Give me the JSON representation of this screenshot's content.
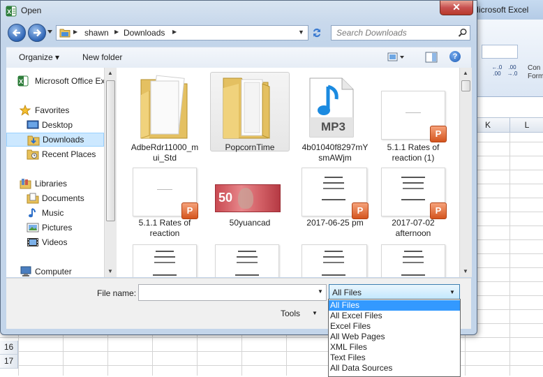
{
  "excel": {
    "title": "Microsoft Excel",
    "columns": [
      "K",
      "L"
    ],
    "rows": [
      "16",
      "17"
    ],
    "ribbon_partial_label": "Con\nForm"
  },
  "dialog": {
    "title": "Open",
    "close_glyph": "✕",
    "address": {
      "segments": [
        "shawn",
        "Downloads"
      ]
    },
    "search": {
      "placeholder": "Search Downloads"
    },
    "toolbar": {
      "organize": "Organize ▾",
      "new_folder": "New folder",
      "help_glyph": "?"
    },
    "nav": {
      "items": [
        {
          "label": "Microsoft Office Ex",
          "icon": "excel-icon"
        },
        {
          "label": "Favorites",
          "icon": "star-icon"
        },
        {
          "label": "Desktop",
          "icon": "desktop-icon"
        },
        {
          "label": "Downloads",
          "icon": "downloads-folder-icon",
          "selected": true
        },
        {
          "label": "Recent Places",
          "icon": "recent-places-icon"
        },
        {
          "label": "Libraries",
          "icon": "libraries-icon"
        },
        {
          "label": "Documents",
          "icon": "documents-icon"
        },
        {
          "label": "Music",
          "icon": "music-icon"
        },
        {
          "label": "Pictures",
          "icon": "pictures-icon"
        },
        {
          "label": "Videos",
          "icon": "videos-icon"
        },
        {
          "label": "Computer",
          "icon": "computer-icon"
        }
      ]
    },
    "files": [
      {
        "label": "AdbeRdr11000_mui_Std",
        "label_lines": [
          "AdbeRdr11000_m",
          "ui_Std"
        ],
        "kind": "folder"
      },
      {
        "label": "PopcornTime",
        "label_lines": [
          "PopcornTime"
        ],
        "kind": "folder",
        "selected": true
      },
      {
        "label": "4b01040f8297mYsmAWjm",
        "label_lines": [
          "4b01040f8297mY",
          "smAWjm"
        ],
        "kind": "mp3",
        "badge": "MP3"
      },
      {
        "label": "5.1.1 Rates of reaction (1)",
        "label_lines": [
          "5.1.1 Rates of",
          "reaction (1)"
        ],
        "kind": "ppt"
      },
      {
        "label": "5.1.1 Rates of reaction",
        "label_lines": [
          "5.1.1 Rates of",
          "reaction"
        ],
        "kind": "ppt"
      },
      {
        "label": "50yuancad",
        "label_lines": [
          "50yuancad"
        ],
        "kind": "image",
        "note_value": "50"
      },
      {
        "label": "2017-06-25 pm",
        "label_lines": [
          "2017-06-25 pm"
        ],
        "kind": "ppt-chinese"
      },
      {
        "label": "2017-07-02 afternoon",
        "label_lines": [
          "2017-07-02",
          "afternoon"
        ],
        "kind": "ppt-chinese"
      },
      {
        "label": "",
        "label_lines": [],
        "kind": "chinese-doc"
      },
      {
        "label": "",
        "label_lines": [],
        "kind": "chinese-doc"
      },
      {
        "label": "",
        "label_lines": [],
        "kind": "chinese-doc"
      },
      {
        "label": "",
        "label_lines": [],
        "kind": "chinese-doc"
      }
    ],
    "file_name": {
      "label": "File name:",
      "value": ""
    },
    "file_type": {
      "value": "All Files"
    },
    "tools": "Tools",
    "file_type_options": [
      {
        "label": "All Files",
        "selected": true
      },
      {
        "label": "All Excel Files"
      },
      {
        "label": "Excel Files"
      },
      {
        "label": "All Web Pages"
      },
      {
        "label": "XML Files"
      },
      {
        "label": "Text Files"
      },
      {
        "label": "All Data Sources"
      }
    ]
  }
}
